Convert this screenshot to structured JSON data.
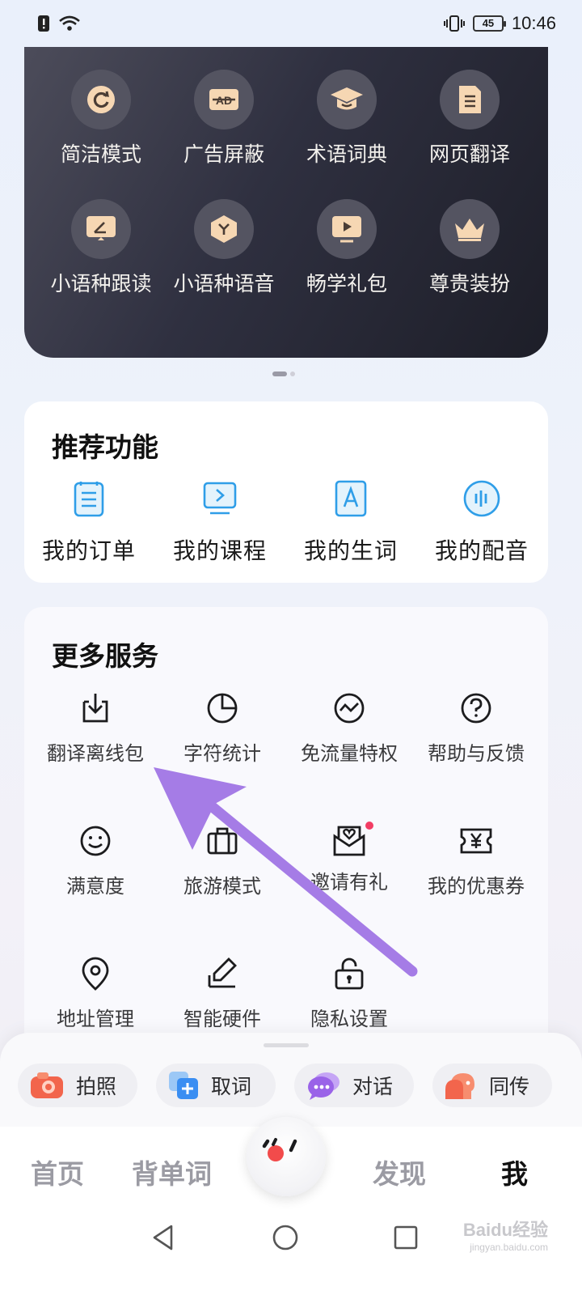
{
  "status_bar": {
    "time": "10:46",
    "battery": "45"
  },
  "vip_features": [
    {
      "label": "简洁模式",
      "icon": "refresh-icon"
    },
    {
      "label": "广告屏蔽",
      "icon": "ad-block-icon"
    },
    {
      "label": "术语词典",
      "icon": "graduation-cap-icon"
    },
    {
      "label": "网页翻译",
      "icon": "document-icon"
    },
    {
      "label": "小语种跟读",
      "icon": "pen-board-icon"
    },
    {
      "label": "小语种语音",
      "icon": "hexagon-voice-icon"
    },
    {
      "label": "畅学礼包",
      "icon": "video-play-icon"
    },
    {
      "label": "尊贵装扮",
      "icon": "crown-icon"
    }
  ],
  "recommended": {
    "title": "推荐功能",
    "items": [
      {
        "label": "我的订单",
        "icon": "order-list-icon"
      },
      {
        "label": "我的课程",
        "icon": "course-screen-icon"
      },
      {
        "label": "我的生词",
        "icon": "word-a-icon"
      },
      {
        "label": "我的配音",
        "icon": "dubbing-wave-icon"
      }
    ]
  },
  "services": {
    "title": "更多服务",
    "items": [
      {
        "label": "翻译离线包",
        "icon": "download-box-icon"
      },
      {
        "label": "字符统计",
        "icon": "pie-chart-icon"
      },
      {
        "label": "免流量特权",
        "icon": "wave-circle-icon"
      },
      {
        "label": "帮助与反馈",
        "icon": "question-icon"
      },
      {
        "label": "满意度",
        "icon": "smile-icon"
      },
      {
        "label": "旅游模式",
        "icon": "suitcase-icon"
      },
      {
        "label": "邀请有礼",
        "icon": "invite-heart-icon"
      },
      {
        "label": "我的优惠券",
        "icon": "coupon-icon"
      },
      {
        "label": "地址管理",
        "icon": "location-pin-icon"
      },
      {
        "label": "智能硬件",
        "icon": "smart-pen-icon"
      },
      {
        "label": "隐私设置",
        "icon": "lock-icon"
      }
    ]
  },
  "quick_tools": [
    {
      "label": "拍照",
      "icon": "camera-icon",
      "color": "#f2654c"
    },
    {
      "label": "取词",
      "icon": "pick-word-icon",
      "color": "#3a8ef2"
    },
    {
      "label": "对话",
      "icon": "chat-icon",
      "color": "#9a63e8"
    },
    {
      "label": "同传",
      "icon": "interpret-head-icon",
      "color": "#f2654c"
    }
  ],
  "bottom_nav": {
    "home": "首页",
    "words": "背单词",
    "discover": "发现",
    "me": "我"
  },
  "watermark": {
    "brand": "Baidu经验",
    "url": "jingyan.baidu.com"
  },
  "colors": {
    "accent": "#2f9ee8",
    "vip_icon": "#f6d7b3",
    "arrow": "#a57ce6"
  }
}
